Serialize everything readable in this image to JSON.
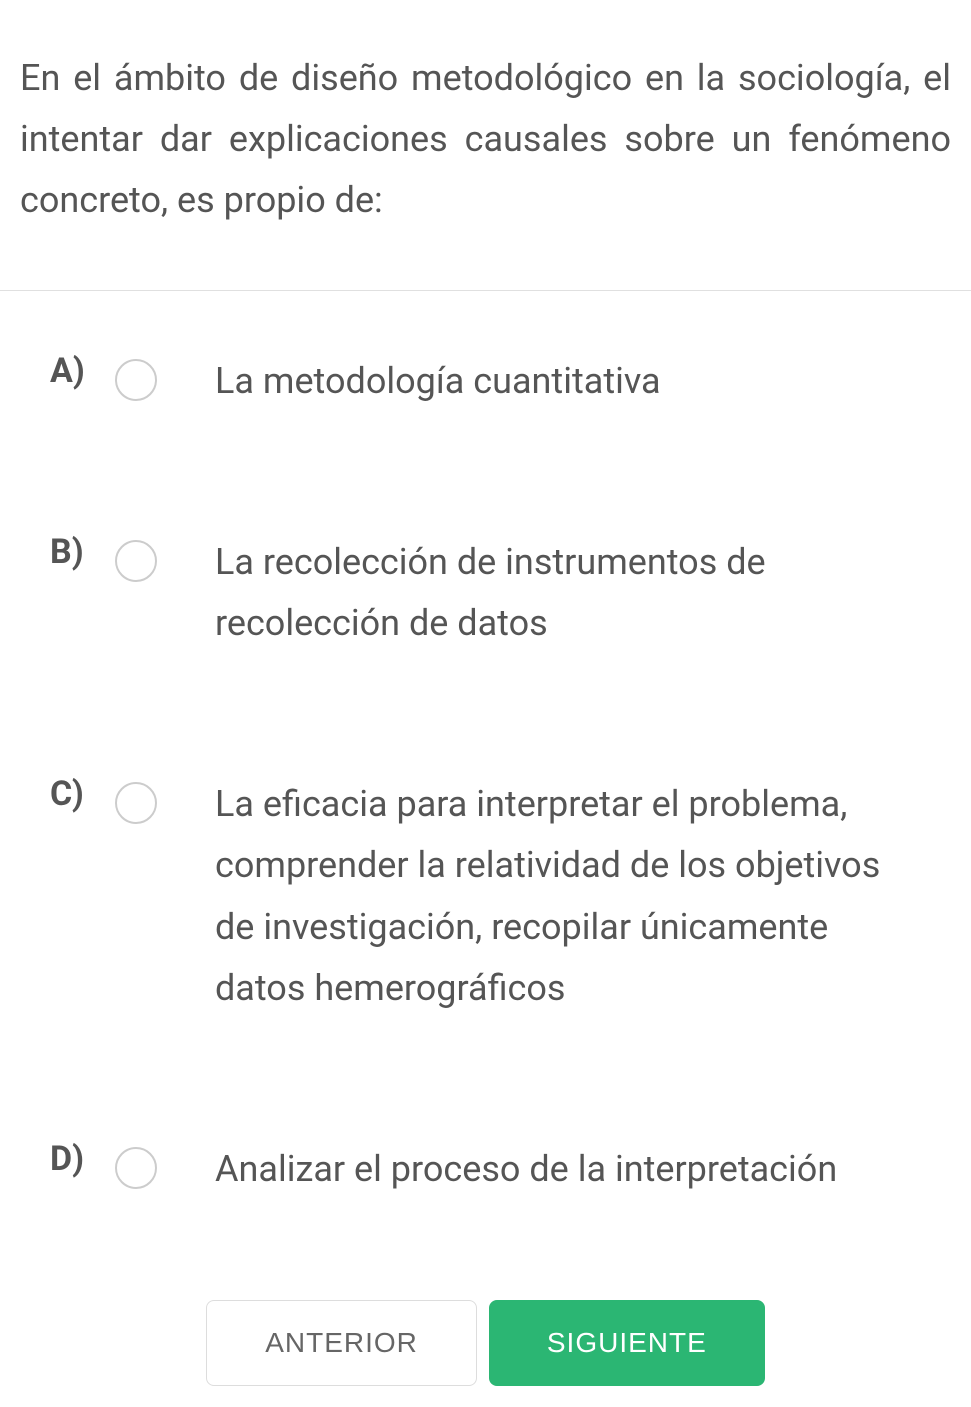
{
  "question": {
    "text": "En el ámbito de diseño metodológico en la sociología, el intentar dar explicaciones causales sobre un fenómeno concreto, es propio de:"
  },
  "options": [
    {
      "letter": "A)",
      "text": "La metodología cuantitativa"
    },
    {
      "letter": "B)",
      "text": "La recolección de instrumentos de recolección de datos"
    },
    {
      "letter": "C)",
      "text": "La eficacia para interpretar el problema, comprender la relatividad de los objetivos de investigación, recopilar únicamente datos hemerográficos"
    },
    {
      "letter": "D)",
      "text": "Analizar el proceso de la interpretación"
    }
  ],
  "buttons": {
    "previous": "ANTERIOR",
    "next": "SIGUIENTE"
  }
}
